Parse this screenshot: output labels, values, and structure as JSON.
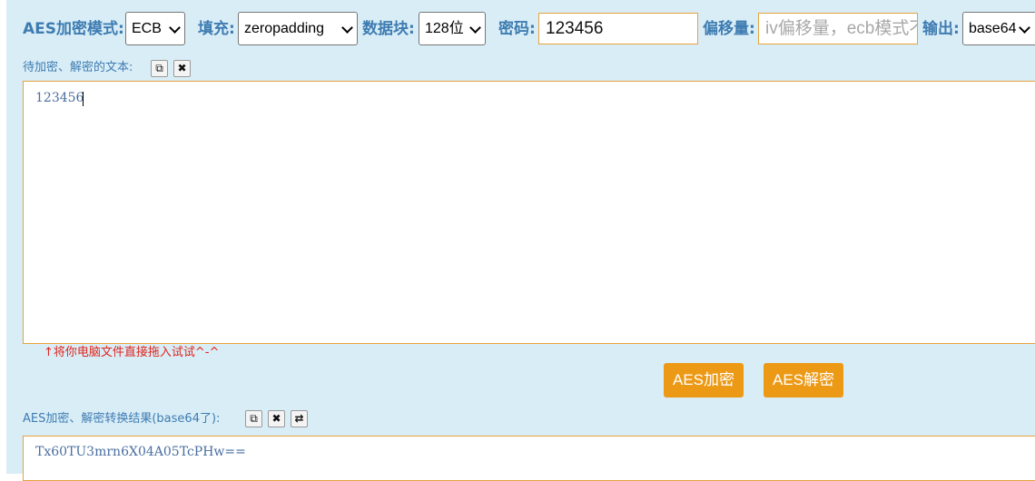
{
  "toolbar": {
    "mode_label": "AES加密模式:",
    "mode_value": "ECB",
    "padding_label": "填充:",
    "padding_value": "zeropadding",
    "block_label": "数据块:",
    "block_value": "128位",
    "key_label": "密码:",
    "key_value": "123456",
    "iv_label": "偏移量:",
    "iv_placeholder": "iv偏移量，ecb模式不用填写！",
    "output_label": "输出:",
    "output_value": "base64"
  },
  "input_section": {
    "label": "待加密、解密的文本:",
    "text": "123456",
    "hint": "↑将你电脑文件直接拖入试试^-^"
  },
  "actions": {
    "encrypt_label": "AES加密",
    "decrypt_label": "AES解密"
  },
  "result_section": {
    "label": "AES加密、解密转换结果(base64了):",
    "text": "Tx60TU3mrn6X04A05TcPHw=="
  },
  "colors": {
    "panel_bg": "#d9edf7",
    "label_blue": "#3e7cb1",
    "accent_orange": "#ec9a16",
    "hint_red": "#e0241b"
  },
  "icons": {
    "copy": "copy-icon",
    "clear": "clear-icon",
    "swap": "swap-icon"
  }
}
